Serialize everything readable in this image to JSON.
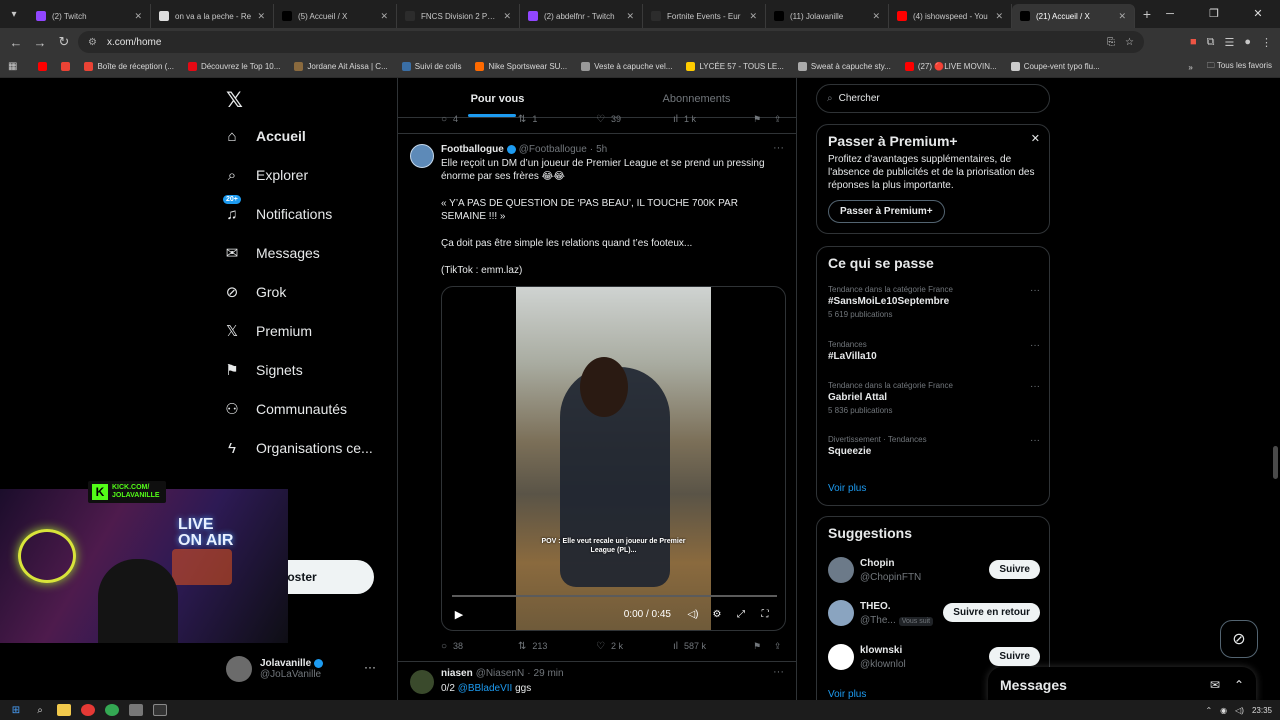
{
  "browser": {
    "tabs": [
      {
        "title": "(2) Twitch",
        "color": "#9146ff"
      },
      {
        "title": "on va a la peche - Re",
        "color": "#dddddd"
      },
      {
        "title": "(5) Accueil / X",
        "color": "#000000"
      },
      {
        "title": "FNCS Division 2 Prac",
        "color": "#2c2c2c"
      },
      {
        "title": "(2) abdelfnr - Twitch",
        "color": "#9146ff"
      },
      {
        "title": "Fortnite Events - Eur",
        "color": "#2c2c2c"
      },
      {
        "title": "(11) Jolavanille",
        "color": "#000000"
      },
      {
        "title": "(4) ishowspeed - You",
        "color": "#ff0000"
      },
      {
        "title": "(21) Accueil / X",
        "color": "#000000",
        "active": true
      }
    ],
    "url": "x.com/home",
    "bookmarks": [
      {
        "label": "",
        "color": "#ff0000"
      },
      {
        "label": "",
        "color": "#ea4335"
      },
      {
        "label": "Boîte de réception (...",
        "color": "#ea4335"
      },
      {
        "label": "Découvrez le Top 10...",
        "color": "#e50914"
      },
      {
        "label": "Jordane Ait Aissa | C...",
        "color": "#8a6a3e"
      },
      {
        "label": "Suivi de colis",
        "color": "#3a6ea5"
      },
      {
        "label": "Nike Sportswear SU...",
        "color": "#ff6a00"
      },
      {
        "label": "Veste à capuche vel...",
        "color": "#999999"
      },
      {
        "label": "LYCÉE 57 - TOUS LE...",
        "color": "#ffcc00"
      },
      {
        "label": "Sweat à capuche sty...",
        "color": "#aaaaaa"
      },
      {
        "label": "(27) 🔴LIVE MOVIN...",
        "color": "#ff0000"
      },
      {
        "label": "Coupe-vent typo flu...",
        "color": "#cccccc"
      }
    ],
    "all_bookmarks": "Tous les favoris"
  },
  "nav": {
    "items": [
      {
        "label": "Accueil",
        "icon": "home-icon",
        "glyph": "⌂",
        "active": true
      },
      {
        "label": "Explorer",
        "icon": "search-icon",
        "glyph": "⌕"
      },
      {
        "label": "Notifications",
        "icon": "bell-icon",
        "glyph": "♫",
        "badge": "20+"
      },
      {
        "label": "Messages",
        "icon": "mail-icon",
        "glyph": "✉"
      },
      {
        "label": "Grok",
        "icon": "grok-icon",
        "glyph": "⊘"
      },
      {
        "label": "Premium",
        "icon": "x-premium-icon",
        "glyph": "𝕏"
      },
      {
        "label": "Signets",
        "icon": "bookmark-icon",
        "glyph": "⚑"
      },
      {
        "label": "Communautés",
        "icon": "communities-icon",
        "glyph": "⚇"
      },
      {
        "label": "Organisations ce...",
        "icon": "lightning-icon",
        "glyph": "ϟ"
      }
    ],
    "post_button": "Poster",
    "profile": {
      "name": "Jolavanille",
      "handle": "@JoLaVanille"
    }
  },
  "stream_overlay": {
    "line1": "KICK.COM/",
    "line2": "JOLAVANILLE",
    "neon": "LIVE\nON AIR"
  },
  "feed": {
    "tabs": [
      "Pour vous",
      "Abonnements"
    ],
    "prev_actions": {
      "replies": "4",
      "reposts": "1",
      "likes": "39",
      "views": "1 k"
    },
    "tweet": {
      "name": "Footballogue",
      "handle": "@Footballogue",
      "time": "5h",
      "paragraphs": [
        "Elle reçoit un DM d’un joueur de Premier League et se prend un pressing énorme par ses frères 😂😂",
        "« Y’A PAS DE QUESTION DE ‘PAS BEAU’, IL TOUCHE 700K PAR SEMAINE !!! »",
        "Ça doit pas être simple les relations quand t’es footeux...",
        "(TikTok : emm.laz)"
      ],
      "video_caption": "POV : Elle veut recale un joueur de Premier League (PL)...",
      "video_time": "0:00 / 0:45",
      "replies": "38",
      "reposts": "213",
      "likes": "2 k",
      "views": "587 k"
    },
    "tweet2": {
      "name": "niasen",
      "handle": "@NiasenN",
      "time": "29 min",
      "text_prefix": "0/2",
      "mention": "@BBladeVII",
      "text_suffix": "ggs"
    }
  },
  "right": {
    "search_placeholder": "Chercher",
    "premium": {
      "title": "Passer à Premium+",
      "desc": "Profitez d'avantages supplémentaires, de l'absence de publicités et de la priorisation des réponses la plus importante.",
      "button": "Passer à Premium+"
    },
    "trends": {
      "title": "Ce qui se passe",
      "items": [
        {
          "cat": "Tendance dans la catégorie France",
          "name": "#SansMoiLe10Septembre",
          "count": "5 619 publications"
        },
        {
          "cat": "Tendances",
          "name": "#LaVilla10",
          "count": ""
        },
        {
          "cat": "Tendance dans la catégorie France",
          "name": "Gabriel Attal",
          "count": "5 836 publications"
        },
        {
          "cat": "Divertissement · Tendances",
          "name": "Squeezie",
          "count": ""
        }
      ],
      "see_more": "Voir plus"
    },
    "suggestions": {
      "title": "Suggestions",
      "items": [
        {
          "name": "Chopin",
          "handle": "@ChopinFTN",
          "button": "Suivre",
          "tag": "",
          "color": "#6c7a89"
        },
        {
          "name": "THEO.",
          "handle": "@The...",
          "button": "Suivre en retour",
          "tag": "Vous suit",
          "color": "#8aa4c0"
        },
        {
          "name": "klownski",
          "handle": "@klownlol",
          "button": "Suivre",
          "tag": "",
          "color": "#ffffff"
        }
      ],
      "see_more": "Voir plus"
    }
  },
  "messages_drawer": {
    "title": "Messages"
  },
  "taskbar": {
    "time": "23:35"
  }
}
